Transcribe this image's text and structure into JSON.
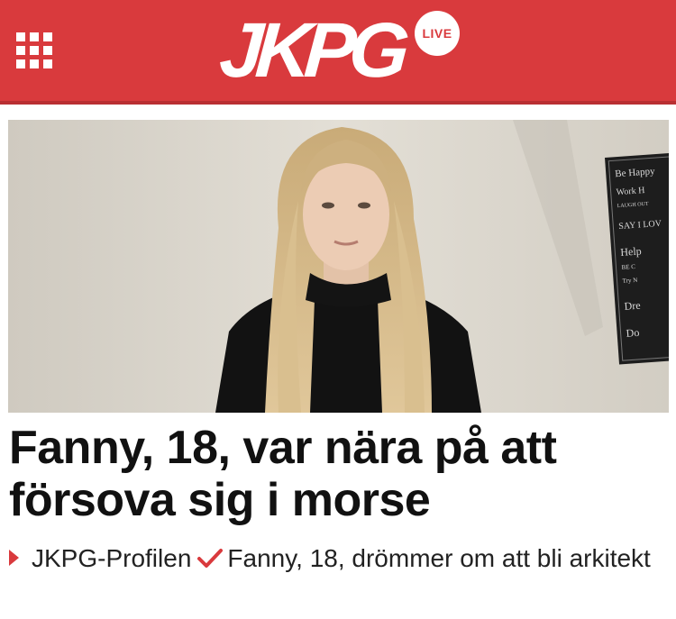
{
  "header": {
    "brand": "JKPG",
    "live_badge": "LIVE",
    "menu_icon": "grid-menu-icon",
    "accent_color": "#d93a3d"
  },
  "article": {
    "image_icon": "article-photo",
    "headline": "Fanny, 18, var nära på att försova sig i morse"
  },
  "related": {
    "section_label": "JKPG-Profilen",
    "link_text": "Fanny, 18, drömmer om att bli arkitekt",
    "arrow_icon": "triangle-right-icon",
    "check_icon": "checkmark-icon"
  }
}
